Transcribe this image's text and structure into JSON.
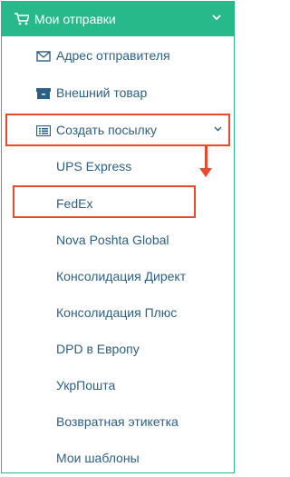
{
  "header": {
    "title": "Мои отправки",
    "cart_icon": "cart-icon",
    "chevron_icon": "chevron-down-icon"
  },
  "menu": {
    "items": [
      {
        "label": "Адрес отправителя",
        "icon": "envelope-icon"
      },
      {
        "label": "Внешний товар",
        "icon": "archive-icon"
      },
      {
        "label": "Создать посылку",
        "icon": "list-icon",
        "expanded": true
      }
    ],
    "subitems": [
      {
        "label": "UPS Express"
      },
      {
        "label": "FedEx"
      },
      {
        "label": "Nova Poshta Global"
      },
      {
        "label": "Консолидация Директ"
      },
      {
        "label": "Консолидация Плюс"
      },
      {
        "label": "DPD в Европу"
      },
      {
        "label": "УкрПошта"
      },
      {
        "label": "Возвратная этикетка"
      },
      {
        "label": "Мои шаблоны"
      }
    ]
  },
  "colors": {
    "accent": "#27b98a",
    "link": "#2c5f86",
    "annotation": "#e84a2b"
  }
}
